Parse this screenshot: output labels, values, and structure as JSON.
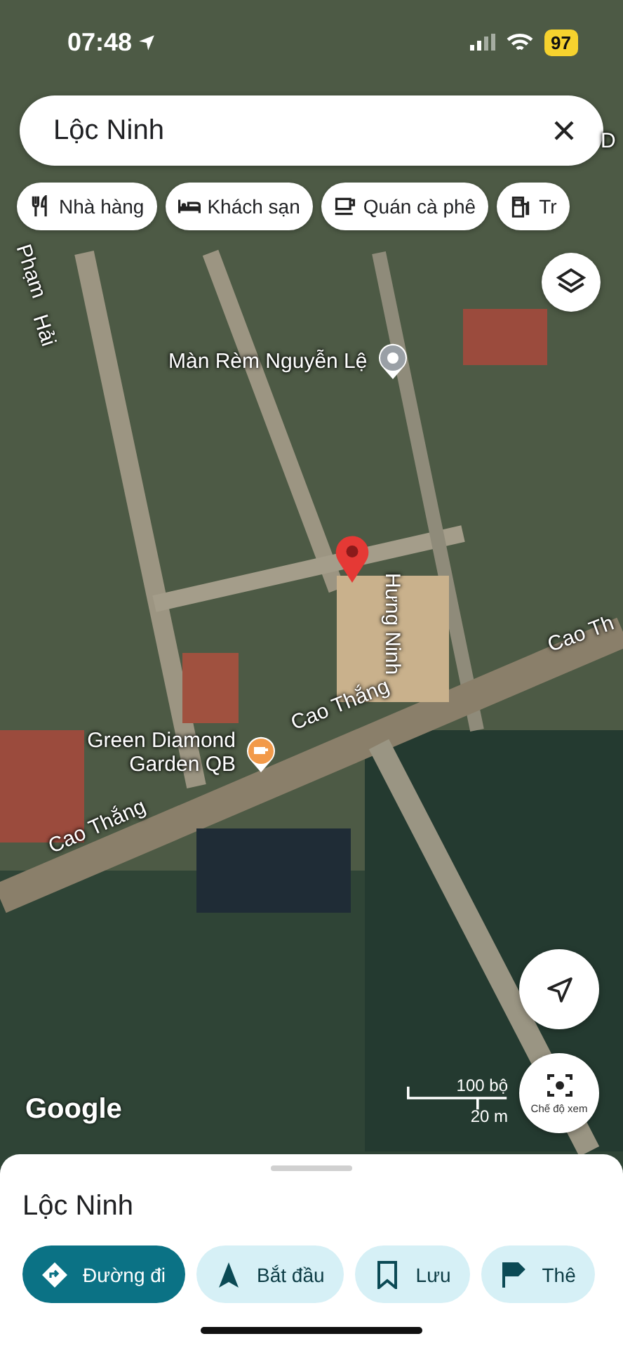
{
  "status_bar": {
    "time": "07:48",
    "battery": "97"
  },
  "search": {
    "value": "Lộc Ninh"
  },
  "chips": [
    {
      "label": "Nhà hàng",
      "kind": "restaurant"
    },
    {
      "label": "Khách sạn",
      "kind": "hotel"
    },
    {
      "label": "Quán cà phê",
      "kind": "cafe"
    },
    {
      "label": "Tr",
      "kind": "fuel"
    }
  ],
  "map": {
    "roads": [
      {
        "name": "Phạm"
      },
      {
        "name": "Hải"
      },
      {
        "name": "D"
      },
      {
        "name": "Hưng Ninh"
      },
      {
        "name": "Cao Th"
      },
      {
        "name": "Cao Thắng"
      },
      {
        "name": "Cao Thắng"
      }
    ],
    "places": [
      {
        "name": "Màn Rèm Nguyễn Lệ",
        "kind": "poi"
      },
      {
        "name": "Green Diamond Garden QB",
        "kind": "cafe"
      }
    ],
    "attribution": "Google",
    "scale": {
      "imperial": "100 bộ",
      "metric": "20 m"
    },
    "view_button": "Chế độ xem"
  },
  "sheet": {
    "title": "Lộc Ninh",
    "actions": [
      {
        "label": "Đường đi",
        "kind": "directions",
        "primary": true
      },
      {
        "label": "Bắt đầu",
        "kind": "start",
        "primary": false
      },
      {
        "label": "Lưu",
        "kind": "save",
        "primary": false
      },
      {
        "label": "Thê",
        "kind": "flag",
        "primary": false
      }
    ]
  }
}
